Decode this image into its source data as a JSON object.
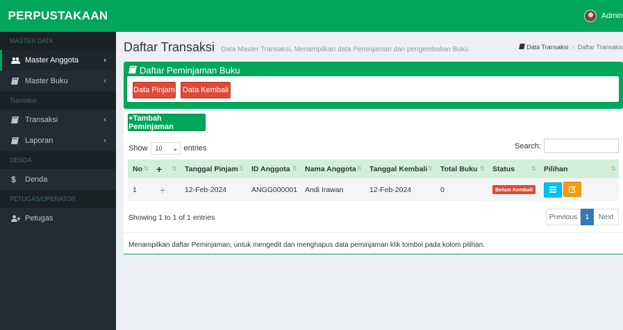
{
  "brand": "PERPUSTAKAAN",
  "user": {
    "name": "Admin"
  },
  "sidebar": {
    "sections": [
      {
        "header": "MASTER DATA"
      },
      {
        "header": "Transaksi"
      },
      {
        "header": "DENDA"
      },
      {
        "header": "PETUGAS/OPERATOR"
      }
    ],
    "items": [
      {
        "label": "Master Anggota",
        "icon": "users-icon",
        "active": true
      },
      {
        "label": "Master Buku",
        "icon": "book-icon"
      },
      {
        "label": "Transaksi",
        "icon": "book-icon"
      },
      {
        "label": "Laporan",
        "icon": "book-icon"
      },
      {
        "label": "Denda",
        "icon": "dollar-icon"
      },
      {
        "label": "Petugas",
        "icon": "user-plus-icon"
      }
    ]
  },
  "header": {
    "title": "Daftar Transaksi",
    "subtitle": "Data Master Transaksi, Menampilkan data Peminjaman dan pengembalian Buku",
    "breadcrumb": [
      "Data Transaksi",
      "Daftar Transaksi"
    ]
  },
  "box": {
    "title": "Daftar Peminjaman Buku",
    "btn_pinjam": "Data Pinjam",
    "btn_kembali": "Data Kembali"
  },
  "table": {
    "add_button": "+Tambah Peminjaman",
    "show_label": "Show",
    "entries_value": "10",
    "entries_label": "entries",
    "search_label": "Search:",
    "search_value": "",
    "columns": [
      "No",
      "+",
      "Tanggal Pinjam",
      "ID Anggota",
      "Nama Anggota",
      "Tanggal Kembali",
      "Total Buku",
      "Status",
      "Pilihan"
    ],
    "rows": [
      {
        "no": "1",
        "expand": "+",
        "tanggal_pinjam": "12-Feb-2024",
        "id_anggota": "ANGG000001",
        "nama_anggota": "Andi Irawan",
        "tanggal_kembali": "12-Feb-2024",
        "total_buku": "0",
        "status": "Belum Kembali"
      }
    ],
    "info": "Showing 1 to 1 of 1 entries",
    "pagination": {
      "previous": "Previous",
      "page": "1",
      "next": "Next"
    },
    "note": "Menampilkan daftar Peminjaman, untuk mengedit dan menghapus data peminjaman klik tombol pada kolom pilihan."
  },
  "colors": {
    "accent": "#00a65a",
    "sidebar": "#222d32",
    "danger": "#dd4b39",
    "info": "#00c0ef",
    "warning": "#f39c12"
  }
}
